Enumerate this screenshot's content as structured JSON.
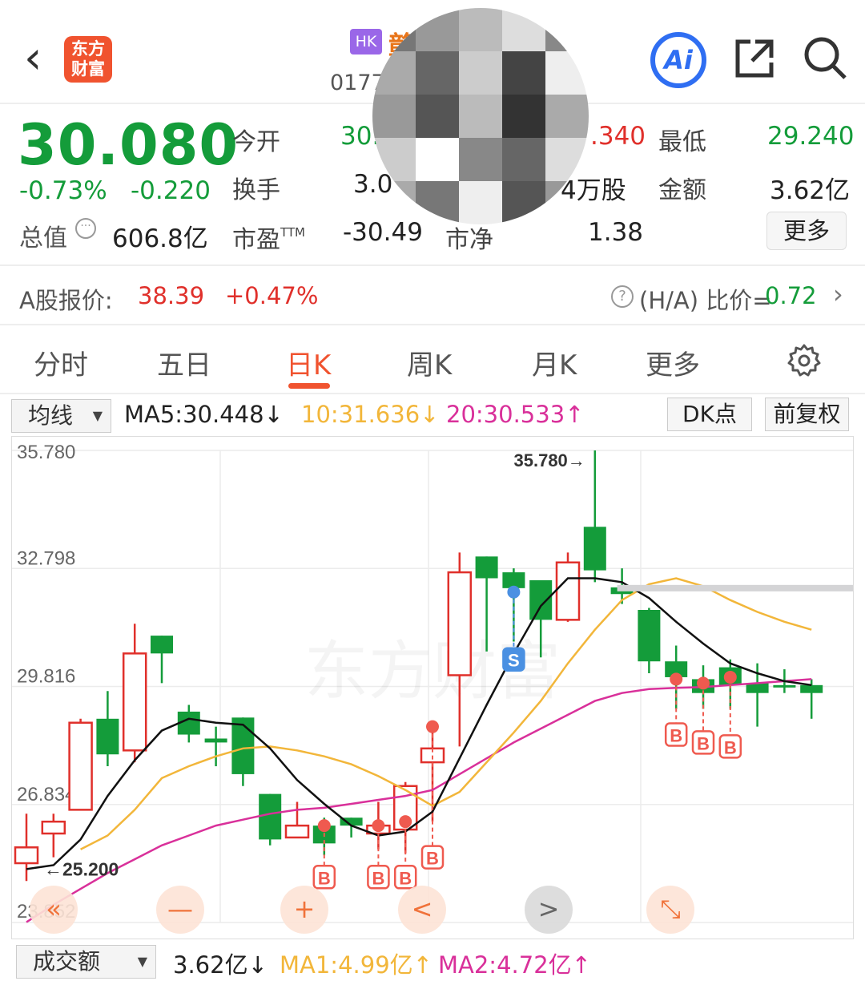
{
  "header": {
    "logo_text": "东方\n财富",
    "market_badge": "HK",
    "stock_name": "赣",
    "stock_code": "0177",
    "ai_label": "Ai"
  },
  "quote": {
    "price": "30.080",
    "change_pct": "-0.73%",
    "change_abs": "-0.220",
    "market_value_label": "总值",
    "market_value": "606.8亿",
    "open_label": "今开",
    "open_value": "30.",
    "high_value": ".340",
    "low_label": "最低",
    "low_value": "29.240",
    "turnover_label": "换手",
    "turnover_value": "3.0",
    "volume_value": "4万股",
    "amount_label": "金额",
    "amount_value": "3.62亿",
    "pe_label": "市盈",
    "pe_sup": "TTM",
    "pe_value": "-30.49",
    "pb_label": "市净",
    "pb_value": "1.38",
    "more_label": "更多"
  },
  "ashare": {
    "label": "A股报价:",
    "price": "38.39",
    "change": "+0.47%",
    "ratio_label": "(H/A) 比价=",
    "ratio_value": "0.72"
  },
  "tabs": [
    {
      "label": "分时"
    },
    {
      "label": "五日"
    },
    {
      "label": "日K",
      "active": true
    },
    {
      "label": "周K"
    },
    {
      "label": "月K"
    },
    {
      "label": "更多"
    }
  ],
  "ma_row": {
    "selector": "均线",
    "ma5": "MA5:30.448↓",
    "ma10": "10:31.636↓",
    "ma20": "20:30.533↑",
    "dk_label": "DK点",
    "fq_label": "前复权"
  },
  "colors": {
    "up": "#e0302b",
    "down": "#149c3a",
    "ma5": "#111111",
    "ma10": "#f2b63a",
    "ma20": "#d9309a",
    "accent": "#f0532f"
  },
  "chart_data": {
    "type": "candlestick",
    "y_ticks": [
      "35.780",
      "32.798",
      "29.816",
      "26.834",
      "23.852"
    ],
    "ylim": [
      23.852,
      35.78
    ],
    "max_label": "35.780→",
    "min_label": "←25.200",
    "watermark": "东方财富",
    "candles": [
      {
        "o": 25.35,
        "c": 25.75,
        "h": 26.6,
        "l": 24.9
      },
      {
        "o": 26.1,
        "c": 26.4,
        "h": 26.6,
        "l": 25.5
      },
      {
        "o": 26.7,
        "c": 28.9,
        "h": 29.0,
        "l": 26.7
      },
      {
        "o": 29.0,
        "c": 28.1,
        "h": 29.7,
        "l": 27.8
      },
      {
        "o": 28.2,
        "c": 30.65,
        "h": 31.4,
        "l": 27.9
      },
      {
        "o": 31.1,
        "c": 30.65,
        "h": 31.1,
        "l": 29.9
      },
      {
        "o": 29.18,
        "c": 28.6,
        "h": 29.35,
        "l": 28.4
      },
      {
        "o": 28.5,
        "c": 28.4,
        "h": 28.8,
        "l": 27.8
      },
      {
        "o": 29.03,
        "c": 27.6,
        "h": 29.03,
        "l": 27.3
      },
      {
        "o": 27.1,
        "c": 25.95,
        "h": 27.1,
        "l": 25.8
      },
      {
        "o": 26.0,
        "c": 26.3,
        "h": 26.9,
        "l": 26.0
      },
      {
        "o": 26.3,
        "c": 25.85,
        "h": 26.5,
        "l": 25.55
      },
      {
        "o": 26.5,
        "c": 26.3,
        "h": 26.5,
        "l": 26.0
      },
      {
        "o": 26.1,
        "c": 26.3,
        "h": 26.9,
        "l": 25.7
      },
      {
        "o": 26.2,
        "c": 27.3,
        "h": 27.4,
        "l": 25.6
      },
      {
        "o": 27.9,
        "c": 28.25,
        "h": 28.8,
        "l": 26.4
      },
      {
        "o": 30.1,
        "c": 32.7,
        "h": 33.2,
        "l": 28.3
      },
      {
        "o": 33.1,
        "c": 32.55,
        "h": 33.1,
        "l": 30.7
      },
      {
        "o": 32.7,
        "c": 32.3,
        "h": 32.8,
        "l": 30.95
      },
      {
        "o": 32.5,
        "c": 31.5,
        "h": 32.5,
        "l": 30.55
      },
      {
        "o": 31.5,
        "c": 32.95,
        "h": 33.2,
        "l": 31.45
      },
      {
        "o": 33.85,
        "c": 32.75,
        "h": 35.78,
        "l": 32.45
      },
      {
        "o": 32.32,
        "c": 32.15,
        "h": 32.8,
        "l": 31.9
      },
      {
        "o": 31.75,
        "c": 30.45,
        "h": 31.8,
        "l": 30.15
      },
      {
        "o": 30.45,
        "c": 30.05,
        "h": 30.85,
        "l": 29.25
      },
      {
        "o": 30.0,
        "c": 29.65,
        "h": 30.35,
        "l": 29.25
      },
      {
        "o": 30.3,
        "c": 29.85,
        "h": 30.5,
        "l": 29.25
      },
      {
        "o": 29.9,
        "c": 29.65,
        "h": 30.4,
        "l": 28.8
      },
      {
        "o": 29.85,
        "c": 29.85,
        "h": 30.25,
        "l": 29.65
      },
      {
        "o": 29.85,
        "c": 29.65,
        "h": 30.0,
        "l": 29.0
      }
    ],
    "ma5": [
      25.2,
      25.3,
      25.95,
      27.05,
      27.95,
      28.7,
      29.0,
      28.9,
      28.85,
      28.25,
      27.45,
      26.85,
      26.3,
      26.05,
      26.15,
      26.65,
      28.0,
      29.35,
      30.65,
      31.85,
      32.55,
      32.55,
      32.45,
      32.05,
      31.45,
      30.9,
      30.4,
      30.15,
      29.95,
      29.85
    ],
    "ma10": [
      null,
      null,
      25.7,
      26.05,
      26.7,
      27.5,
      27.8,
      28.05,
      28.25,
      28.3,
      28.2,
      28.05,
      27.85,
      27.55,
      27.2,
      26.8,
      27.15,
      27.9,
      28.65,
      29.45,
      30.4,
      31.25,
      32.0,
      32.4,
      32.55,
      32.35,
      32.0,
      31.7,
      31.45,
      31.25
    ],
    "ma20": [
      23.86,
      24.3,
      24.7,
      25.1,
      25.45,
      25.8,
      26.05,
      26.3,
      26.45,
      26.6,
      26.7,
      26.75,
      26.85,
      26.95,
      27.05,
      27.2,
      27.6,
      28.0,
      28.4,
      28.75,
      29.1,
      29.45,
      29.65,
      29.75,
      29.78,
      29.8,
      29.85,
      29.9,
      29.95,
      30.0
    ],
    "signals": [
      {
        "index": 11,
        "type": "B",
        "price": 26.3,
        "label_y": 25.0
      },
      {
        "index": 13,
        "type": "B",
        "price": 26.3,
        "label_y": 25.0
      },
      {
        "index": 14,
        "type": "B",
        "price": 26.4,
        "label_y": 25.0
      },
      {
        "index": 15,
        "type": "B",
        "price": 28.8,
        "label_y": 25.5
      },
      {
        "index": 18,
        "type": "S",
        "price": 32.2,
        "label_y": 30.5
      },
      {
        "index": 24,
        "type": "B",
        "price": 30.0,
        "label_y": 28.6
      },
      {
        "index": 25,
        "type": "B",
        "price": 29.9,
        "label_y": 28.4
      },
      {
        "index": 26,
        "type": "B",
        "price": 30.05,
        "label_y": 28.3
      }
    ],
    "controls": [
      "«",
      "—",
      "+",
      "<",
      ">",
      "⤡"
    ]
  },
  "volume_row": {
    "selector": "成交额",
    "value": "3.62亿↓",
    "ma1": "MA1:4.99亿↑",
    "ma2": "MA2:4.72亿↑"
  }
}
